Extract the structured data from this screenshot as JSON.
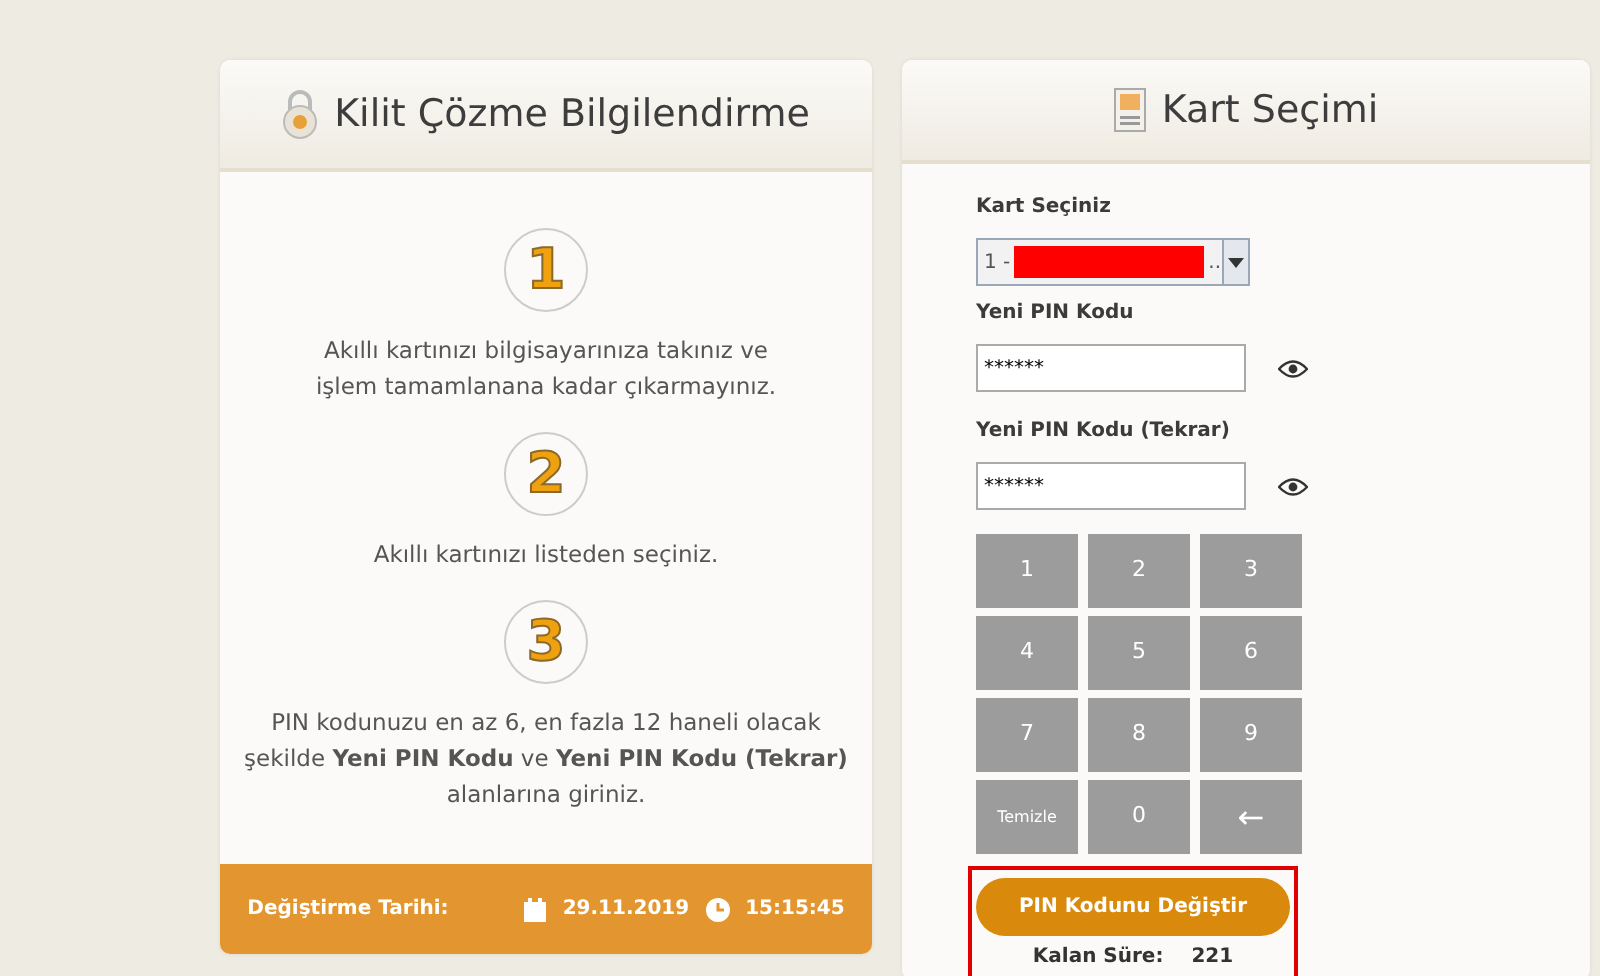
{
  "info_panel": {
    "title": "Kilit Çözme Bilgilendirme",
    "steps": [
      {
        "number": "1",
        "text": "Akıllı kartınızı bilgisayarınıza takınız ve işlem tamamlanana kadar çıkarmayınız."
      },
      {
        "number": "2",
        "text": "Akıllı kartınızı listeden seçiniz."
      },
      {
        "number": "3",
        "text": "PIN kodunuzu en az 6, en fazla 12 haneli olacak şekilde **Yeni PIN Kodu** ve **Yeni PIN Kodu (Tekrar)** alanlarına giriniz."
      }
    ],
    "footer": {
      "label": "Değiştirme Tarihi:",
      "date": "29.11.2019",
      "time": "15:15:45"
    }
  },
  "card_panel": {
    "title": "Kart Seçimi",
    "card_select": {
      "label": "Kart Seçiniz",
      "value": "1 -",
      "suffix": ".."
    },
    "pin_fields": [
      {
        "label": "Yeni PIN Kodu",
        "value": "******"
      },
      {
        "label": "Yeni PIN Kodu (Tekrar)",
        "value": "******"
      }
    ],
    "keypad": [
      {
        "label": "1",
        "kind": "digit"
      },
      {
        "label": "2",
        "kind": "digit"
      },
      {
        "label": "3",
        "kind": "digit"
      },
      {
        "label": "4",
        "kind": "digit"
      },
      {
        "label": "5",
        "kind": "digit"
      },
      {
        "label": "6",
        "kind": "digit"
      },
      {
        "label": "7",
        "kind": "digit"
      },
      {
        "label": "8",
        "kind": "digit"
      },
      {
        "label": "9",
        "kind": "digit"
      },
      {
        "label": "Temizle",
        "kind": "clear"
      },
      {
        "label": "0",
        "kind": "digit"
      },
      {
        "label": "←",
        "kind": "back"
      }
    ],
    "submit": "PIN Kodunu Değiştir",
    "timer": {
      "label": "Kalan Süre:",
      "value": "221"
    }
  }
}
